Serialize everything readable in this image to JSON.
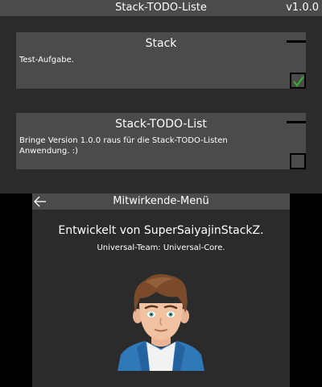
{
  "top_screen": {
    "title": "Stack-TODO-Liste",
    "version": "v1.0.0",
    "tasks": [
      {
        "title": "Stack",
        "description": "Test-Aufgabe.",
        "done": true
      },
      {
        "title": "Stack-TODO-List",
        "description": "Bringe Version 1.0.0 raus für die Stack-TODO-Listen Anwendung. :)",
        "done": false
      }
    ]
  },
  "bottom_screen": {
    "title": "Mitwirkende-Menü",
    "back_icon": "arrow-left-icon",
    "developer_line": "Entwickelt von SuperSaiyajinStackZ.",
    "team_line": "Universal-Team: Universal-Core.",
    "avatar_icon": "developer-avatar"
  },
  "colors": {
    "background": "#2b2b2b",
    "bar": "#4b4b4b",
    "text": "#ffffff",
    "checkmark": "#2fb52f"
  }
}
